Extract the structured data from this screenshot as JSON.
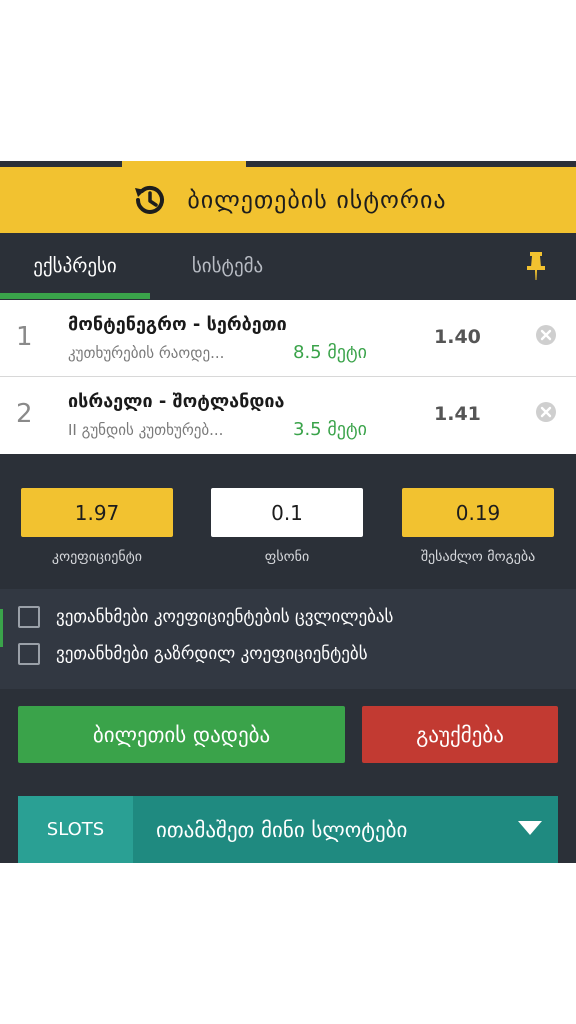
{
  "header": {
    "title": "ბილეთების ისტორია",
    "icon": "history-icon"
  },
  "tabs": [
    {
      "label": "ექსპრესი",
      "active": true
    },
    {
      "label": "სისტემა",
      "active": false
    }
  ],
  "bets": [
    {
      "number": "1",
      "match": "მონტენეგრო - სერბეთი",
      "market": "კუთხურების რაოდე...",
      "pick": "8.5 მეტი",
      "odds": "1.40"
    },
    {
      "number": "2",
      "match": "ისრაელი - შოტლანდია",
      "market": "II გუნდის კუთხურებ...",
      "pick": "3.5 მეტი",
      "odds": "1.41"
    }
  ],
  "summary": {
    "coefficient": {
      "value": "1.97",
      "label": "კოეფიციენტი"
    },
    "stake": {
      "value": "0.1",
      "label": "ფსონი"
    },
    "potential_win": {
      "value": "0.19",
      "label": "შესაძლო მოგება"
    }
  },
  "options": [
    {
      "label": "ვეთანხმები კოეფიციენტების ცვლილებას",
      "checked": false
    },
    {
      "label": "ვეთანხმები გაზრდილ კოეფიციენტებს",
      "checked": false
    }
  ],
  "actions": {
    "place_label": "ბილეთის დადება",
    "cancel_label": "გაუქმება"
  },
  "slots": {
    "tag": "SLOTS",
    "title": "ითამაშეთ მინი სლოტები"
  },
  "colors": {
    "yellow": "#f2c230",
    "green": "#3aa34a",
    "red": "#c23a32",
    "dark": "#2b3038",
    "teal": "#1f8a80"
  }
}
